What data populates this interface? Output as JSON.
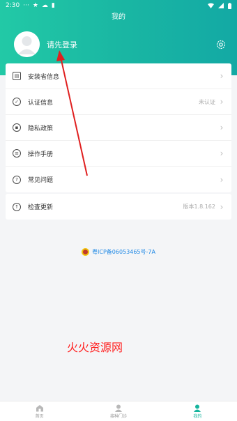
{
  "status_bar": {
    "time": "2:30",
    "extra": "···"
  },
  "header": {
    "title": "我的",
    "login_text": "请先登录"
  },
  "menu": [
    {
      "label": "安装省信息",
      "value": "",
      "icon": "id-card-icon"
    },
    {
      "label": "认证信息",
      "value": "未认证",
      "icon": "shield-icon"
    },
    {
      "label": "隐私政策",
      "value": "",
      "icon": "lock-icon"
    },
    {
      "label": "操作手册",
      "value": "",
      "icon": "manual-icon"
    },
    {
      "label": "常见问题",
      "value": "",
      "icon": "question-icon"
    }
  ],
  "update": {
    "label": "检查更新",
    "value": "版本1.8.162",
    "icon": "upload-icon"
  },
  "icp": "粤ICP备06053465号-7A",
  "watermark": "火火资源网",
  "tabs": [
    {
      "label": "首页",
      "active": false
    },
    {
      "label": "接种门诊",
      "active": false
    },
    {
      "label": "我的",
      "active": true
    }
  ],
  "colors": {
    "accent": "#15b49d",
    "header_start": "#22c9a6",
    "header_end": "#13a9a4",
    "arrow": "#e02020"
  }
}
